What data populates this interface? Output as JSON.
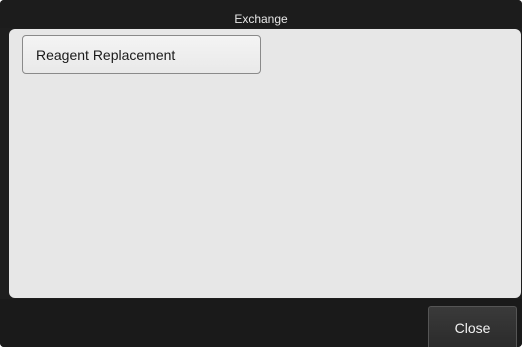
{
  "window": {
    "title": "Exchange"
  },
  "content": {
    "items": [
      {
        "label": "Reagent Replacement"
      }
    ]
  },
  "footer": {
    "close_label": "Close"
  }
}
